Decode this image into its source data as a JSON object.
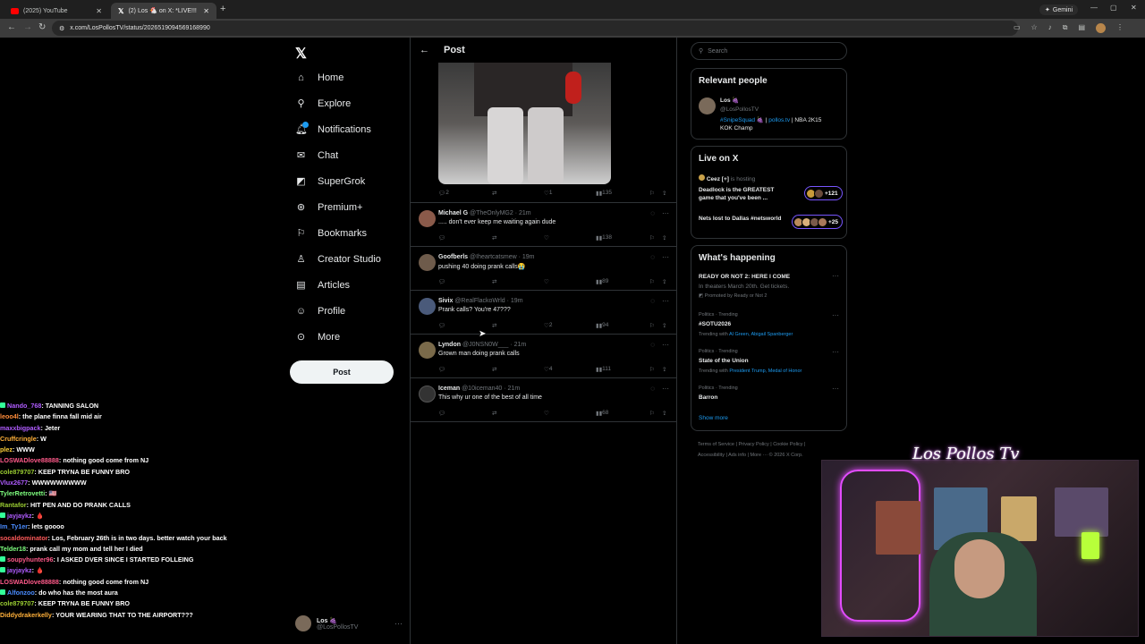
{
  "browser": {
    "tabs": [
      {
        "label": "(2025) YouTube",
        "icon": "youtube-icon"
      },
      {
        "label": "(2) Los 🐔 on X: *LIVE!!! PRANK",
        "icon": "x-logo-icon"
      }
    ],
    "url": "x.com/LosPollosTV/status/2026519094569168990",
    "gemini_label": "Gemini"
  },
  "nav": {
    "items": [
      {
        "label": "Home",
        "icon": "home-icon"
      },
      {
        "label": "Explore",
        "icon": "search-icon"
      },
      {
        "label": "Notifications",
        "icon": "bell-icon"
      },
      {
        "label": "Chat",
        "icon": "mail-icon"
      },
      {
        "label": "SuperGrok",
        "icon": "grok-icon"
      },
      {
        "label": "Premium+",
        "icon": "verified-icon"
      },
      {
        "label": "Bookmarks",
        "icon": "bookmark-icon"
      },
      {
        "label": "Creator Studio",
        "icon": "creator-studio-icon"
      },
      {
        "label": "Articles",
        "icon": "articles-icon"
      },
      {
        "label": "Profile",
        "icon": "profile-icon"
      },
      {
        "label": "More",
        "icon": "more-icon"
      }
    ],
    "post_button": "Post",
    "profile": {
      "name": "Los 🍇",
      "handle": "@LosPollosTV"
    }
  },
  "post": {
    "header_title": "Post",
    "main_actions": {
      "replies": "2",
      "likes": "1",
      "views": "135"
    },
    "replies": [
      {
        "name": "Michael G",
        "handle": "@TheOnlyMG2 · 21m",
        "text": "..... don't ever keep me waiting again dude",
        "replies": "",
        "reposts": "",
        "likes": "",
        "views": "138",
        "avatar_color": "#8a5a4a"
      },
      {
        "name": "Goofberls",
        "handle": "@Iheartcatsmew · 19m",
        "text": "pushing 40 doing prank calls😭",
        "replies": "",
        "reposts": "",
        "likes": "",
        "views": "89",
        "avatar_color": "#6e5b4b"
      },
      {
        "name": "Sivix",
        "handle": "@RealFlackoWrld · 19m",
        "text": "Prank calls? You're 47???",
        "replies": "",
        "reposts": "",
        "likes": "2",
        "views": "94",
        "avatar_color": "#4a5a7a"
      },
      {
        "name": "Lyndon",
        "handle": "@J0NSN0W___ · 21m",
        "text": "Grown man doing prank calls",
        "replies": "",
        "reposts": "",
        "likes": "4",
        "views": "111",
        "avatar_color": "#7a6a4a"
      },
      {
        "name": "Iceman",
        "handle": "@10iceman40 · 21m",
        "text": "This why ur one of the best of all time",
        "replies": "",
        "reposts": "",
        "likes": "",
        "views": "68",
        "avatar_color": "#333"
      }
    ]
  },
  "sidebar": {
    "search_placeholder": "Search",
    "relevant": {
      "title": "Relevant people",
      "name": "Los 🍇",
      "handle": "@LosPollosTV",
      "bio_tag": "#SnipeSquad 🍇",
      "bio_sep": " | ",
      "bio_link": "pollos.tv",
      "bio_rest": " | NBA 2K15",
      "bio_line2": "KOK Champ"
    },
    "live": {
      "title": "Live on X",
      "host": "Ceez [+]",
      "hosting": "is hosting",
      "space1": "Deadlock is the GREATEST game that you've been ...",
      "space1_count": "+121",
      "space2": "Nets lost to Dallas #netsworld",
      "space2_count": "+25"
    },
    "happening": {
      "title": "What's happening",
      "items": [
        {
          "meta": "",
          "title": "READY OR NOT 2: HERE I COME",
          "sub": "In theaters March 20th. Get tickets.",
          "promo": "Promoted by Ready or Not 2"
        },
        {
          "meta": "Politics · Trending",
          "title": "#SOTU2026",
          "sub_prefix": "Trending with ",
          "sub_links": "Al Green, Abigail Spanberger"
        },
        {
          "meta": "Politics · Trending",
          "title": "State of the Union",
          "sub_prefix": "Trending with ",
          "sub_links": "President Trump, Medal of Honor"
        },
        {
          "meta": "Politics · Trending",
          "title": "Barron"
        }
      ],
      "show_more": "Show more"
    },
    "footer": [
      "Terms of Service",
      "Privacy Policy",
      "Cookie Policy",
      "Accessibility",
      "Ads info",
      "More ···",
      "© 2026 X Corp."
    ]
  },
  "chat": [
    {
      "user": "Nando_768",
      "msg": "TANNING SALON",
      "color": "#b05cff",
      "badge": "#3f9"
    },
    {
      "user": "leoo4l",
      "msg": "the plane finna fall mid air",
      "color": "#ff8c3a"
    },
    {
      "user": "maxxbigpack",
      "msg": "Jeter",
      "color": "#b05cff"
    },
    {
      "user": "Cruffcringle",
      "msg": "W",
      "color": "#ffb03a"
    },
    {
      "user": "plez",
      "msg": "WWW",
      "color": "#ffd23a"
    },
    {
      "user": "LOSWADlove88888",
      "msg": "nothing good come from NJ",
      "color": "#ff5a8a"
    },
    {
      "user": "cole879707",
      "msg": "KEEP TRYNA BE FUNNY BRO",
      "color": "#9acd32"
    },
    {
      "user": "Vlux2677",
      "msg": "WWWWWWWWW",
      "color": "#b05cff"
    },
    {
      "user": "TylerRetrovetti",
      "msg": "🇺🇸",
      "color": "#7fff7f"
    },
    {
      "user": "Rantafor",
      "msg": "HIT PEN AND DO PRANK CALLS",
      "color": "#9acd32"
    },
    {
      "user": "jayjaykz",
      "msg": "🩸",
      "color": "#b05cff",
      "badge": "#3f9"
    },
    {
      "user": "Im_Ty1er",
      "msg": "lets goooo",
      "color": "#4a8cff"
    },
    {
      "user": "socaldominator",
      "msg": "Los, February 26th is in two days. better watch your back",
      "color": "#ff5a5a"
    },
    {
      "user": "Telder18",
      "msg": "prank call my mom and tell her I died",
      "color": "#7fff7f"
    },
    {
      "user": "soupyhunter96",
      "msg": "I ASKED DVER SINCE I STARTED FOLLEING",
      "color": "#ff5a8a",
      "badge": "#3f9"
    },
    {
      "user": "jayjaykz",
      "msg": "🩸",
      "color": "#b05cff",
      "badge": "#3f9"
    },
    {
      "user": "LOSWADlove88888",
      "msg": "nothing good come from NJ",
      "color": "#ff5a8a"
    },
    {
      "user": "Alfonzoo",
      "msg": "do who has the most aura",
      "color": "#4a8cff",
      "badge": "#3f9"
    },
    {
      "user": "cole879707",
      "msg": "KEEP TRYNA BE FUNNY BRO",
      "color": "#9acd32"
    },
    {
      "user": "Diddydrakerkelly",
      "msg": "YOUR WEARING THAT TO THE AIRPORT???",
      "color": "#ffb03a"
    }
  ],
  "webcam": {
    "logo_text": "Los Pollos Tv"
  }
}
